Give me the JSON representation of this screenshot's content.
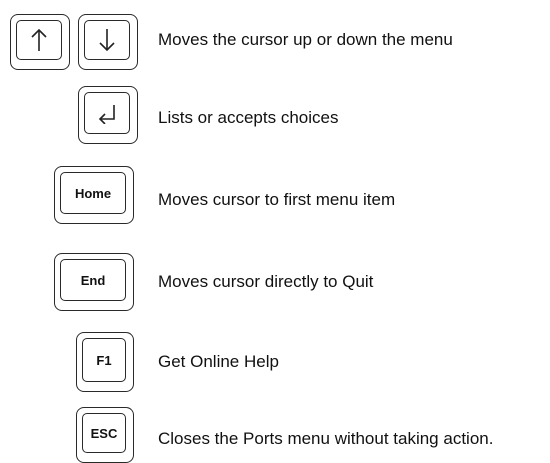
{
  "rows": [
    {
      "keys": [
        "up-arrow",
        "down-arrow"
      ],
      "description": "Moves the cursor up or down the menu"
    },
    {
      "keys": [
        "enter-arrow"
      ],
      "description": "Lists or accepts choices"
    },
    {
      "keys": [
        "Home"
      ],
      "description": "Moves cursor to first menu item"
    },
    {
      "keys": [
        "End"
      ],
      "description": "Moves cursor directly to Quit"
    },
    {
      "keys": [
        "F1"
      ],
      "description": "Get Online Help"
    },
    {
      "keys": [
        "ESC"
      ],
      "description": "Closes the Ports menu without taking action."
    }
  ],
  "key_labels": {
    "home": "Home",
    "end": "End",
    "f1": "F1",
    "esc": "ESC"
  },
  "icons": [
    "up-arrow-icon",
    "down-arrow-icon",
    "enter-arrow-icon"
  ]
}
